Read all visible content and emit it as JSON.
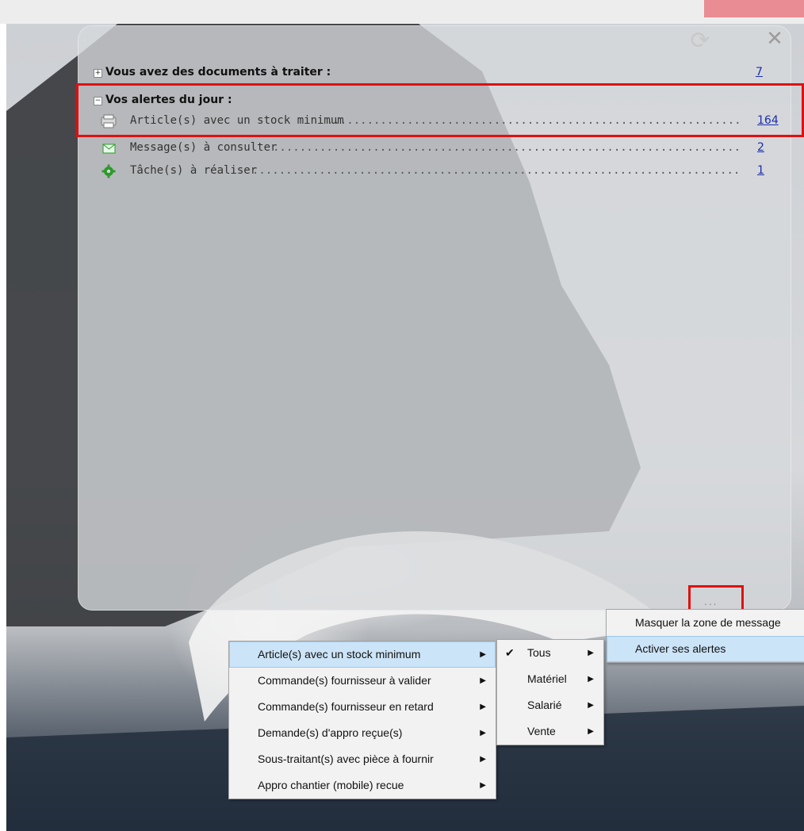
{
  "panel": {
    "documents": {
      "title": "Vous avez des documents à traiter :",
      "count": "7",
      "toggle": "+"
    },
    "alerts": {
      "title": "Vos alertes du jour :",
      "toggle": "−",
      "items": [
        {
          "icon": "printer-icon",
          "label": "Article(s) avec un stock minimum",
          "count": "164"
        },
        {
          "icon": "envelope-icon",
          "label": "Message(s) à consulter",
          "count": "2"
        },
        {
          "icon": "gear-icon",
          "label": "Tâche(s) à réaliser",
          "count": "1"
        }
      ]
    },
    "refresh_glyph": "⟳",
    "close_glyph": "✕",
    "more_glyph": "..."
  },
  "dots": "...........................................................................................................",
  "menus": {
    "main": [
      {
        "label": "Article(s) avec un stock minimum",
        "arrow": "▶"
      },
      {
        "label": "Commande(s) fournisseur à valider",
        "arrow": "▶"
      },
      {
        "label": "Commande(s) fournisseur en retard",
        "arrow": "▶"
      },
      {
        "label": "Demande(s) d'appro reçue(s)",
        "arrow": "▶"
      },
      {
        "label": "Sous-traitant(s) avec pièce à fournir",
        "arrow": "▶"
      },
      {
        "label": "Appro chantier (mobile) recue",
        "arrow": "▶"
      }
    ],
    "category": [
      {
        "label": "Tous",
        "arrow": "▶",
        "check": "✔"
      },
      {
        "label": "Matériel",
        "arrow": "▶"
      },
      {
        "label": "Salarié",
        "arrow": "▶"
      },
      {
        "label": "Vente",
        "arrow": "▶"
      }
    ],
    "options": [
      {
        "label": "Masquer la zone de message"
      },
      {
        "label": "Activer ses alertes"
      }
    ]
  },
  "colors": {
    "highlight": "#e01010",
    "link": "#1a2db0",
    "menu_hover": "#cce4f7"
  }
}
